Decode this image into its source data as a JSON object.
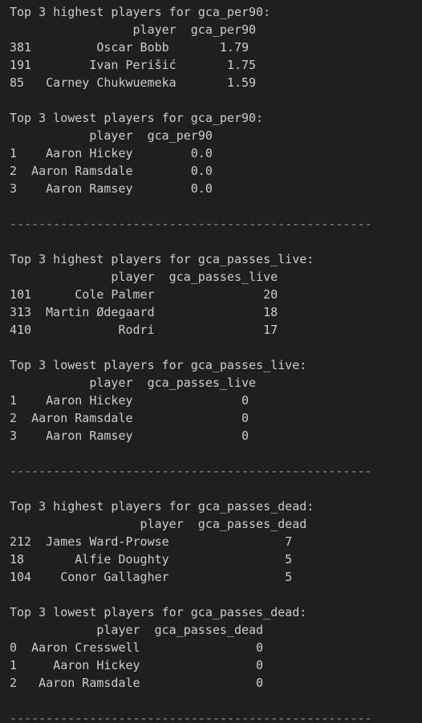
{
  "terminal": {
    "lines": [
      "Top 3 highest players for gca_per90:",
      "                 player  gca_per90",
      "381         Oscar Bobb       1.79",
      "191        Ivan Perišić       1.75",
      "85   Carney Chukwuemeka       1.59",
      "",
      "Top 3 lowest players for gca_per90:",
      "           player  gca_per90",
      "1    Aaron Hickey        0.0",
      "2  Aaron Ramsdale        0.0",
      "3    Aaron Ramsey        0.0",
      "",
      "--------------------------------------------------",
      "",
      "Top 3 highest players for gca_passes_live:",
      "              player  gca_passes_live",
      "101      Cole Palmer               20",
      "313  Martin Ødegaard               18",
      "410            Rodri               17",
      "",
      "Top 3 lowest players for gca_passes_live:",
      "           player  gca_passes_live",
      "1    Aaron Hickey               0",
      "2  Aaron Ramsdale               0",
      "3    Aaron Ramsey               0",
      "",
      "--------------------------------------------------",
      "",
      "Top 3 highest players for gca_passes_dead:",
      "                  player  gca_passes_dead",
      "212  James Ward-Prowse                7",
      "18       Alfie Doughty                5",
      "104    Conor Gallagher                5",
      "",
      "Top 3 lowest players for gca_passes_dead:",
      "            player  gca_passes_dead",
      "0  Aaron Cresswell                0",
      "1     Aaron Hickey                0",
      "2   Aaron Ramsdale                0",
      "",
      "--------------------------------------------------"
    ]
  }
}
